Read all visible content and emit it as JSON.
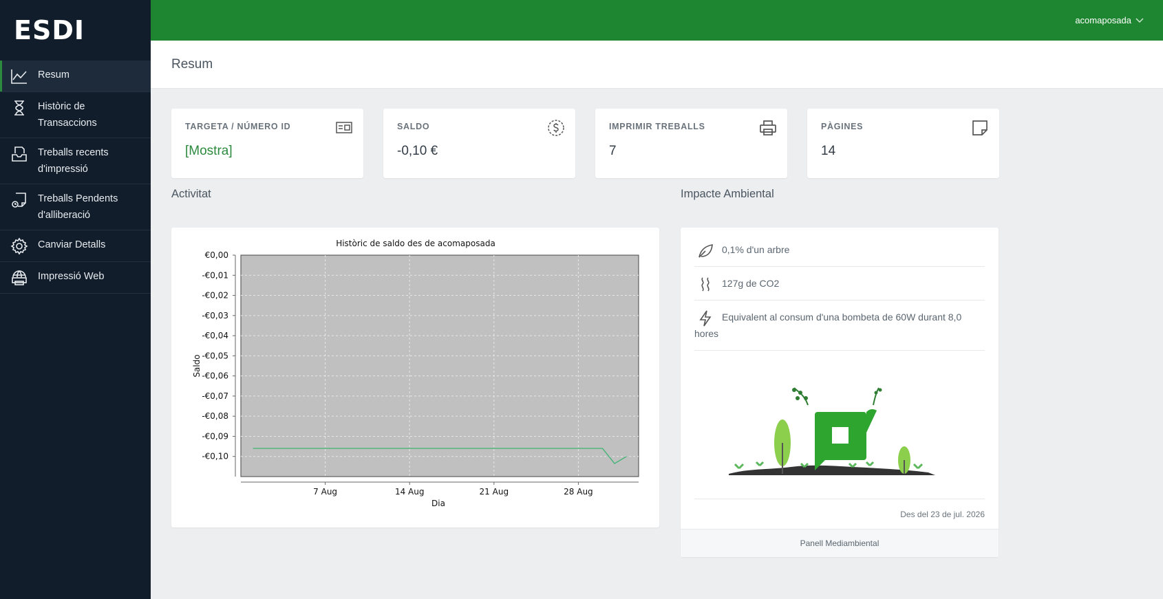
{
  "app": {
    "logo": "ESDI",
    "user": "acomaposada"
  },
  "sidebar": {
    "items": [
      {
        "label": "Resum",
        "icon": "line-chart-icon",
        "active": true
      },
      {
        "label": "Històric de Transaccions",
        "icon": "hourglass-icon"
      },
      {
        "label": "Treballs recents d'impressió",
        "icon": "printer-tray-icon"
      },
      {
        "label": "Treballs Pendents d'alliberació",
        "icon": "pending-job-icon"
      },
      {
        "label": "Canviar Detalls",
        "icon": "gear-icon"
      },
      {
        "label": "Impressió Web",
        "icon": "web-print-icon"
      }
    ]
  },
  "header": {
    "title": "Resum"
  },
  "cards": [
    {
      "label": "TARGETA / NÚMERO ID",
      "value": "[Mostra]",
      "icon": "id-card-icon"
    },
    {
      "label": "SALDO",
      "value": "-0,10 €",
      "icon": "dollar-coin-icon"
    },
    {
      "label": "IMPRIMIR TREBALLS",
      "value": "7",
      "icon": "printer-icon"
    },
    {
      "label": "PÀGINES",
      "value": "14",
      "icon": "page-icon"
    }
  ],
  "activity": {
    "title": "Activitat"
  },
  "chart_data": {
    "type": "line",
    "title": "Històric de saldo des de acomaposada",
    "xlabel": "Dia",
    "ylabel": "Saldo",
    "x_ticks": [
      "7 Aug",
      "14 Aug",
      "21 Aug",
      "28 Aug"
    ],
    "y_ticks": [
      "€0,00",
      "-€0,01",
      "-€0,02",
      "-€0,03",
      "-€0,04",
      "-€0,05",
      "-€0,06",
      "-€0,07",
      "-€0,08",
      "-€0,09",
      "-€0,10"
    ],
    "ylim": [
      -0.11,
      0.0
    ],
    "xlim": [
      "2026-07-31",
      "2026-09-02"
    ],
    "grid": true,
    "background": "#c0c0c0",
    "line_color": "#3cb371",
    "series": [
      {
        "points": [
          {
            "x": "2026-08-01",
            "y": -0.096
          },
          {
            "x": "2026-08-29",
            "y": -0.096
          },
          {
            "x": "2026-08-30",
            "y": -0.096
          },
          {
            "x": "2026-08-31",
            "y": -0.1035
          },
          {
            "x": "2026-09-01",
            "y": -0.1
          }
        ]
      }
    ]
  },
  "impact": {
    "title": "Impacte Ambiental",
    "rows": [
      {
        "icon": "leaf-icon",
        "text": "0,1% d'un arbre"
      },
      {
        "icon": "steam-icon",
        "text": "127g de CO2"
      },
      {
        "icon": "lightning-icon",
        "text": "Equivalent al consum d'una bombeta de 60W durant 8,0 hores"
      }
    ],
    "since": "Des del 23 de jul. 2026",
    "footer": "Panell Mediambiental"
  },
  "colors": {
    "brand_green": "#1e8630",
    "sidebar_bg": "#111d2b",
    "accent_link": "#2b8a3e"
  }
}
